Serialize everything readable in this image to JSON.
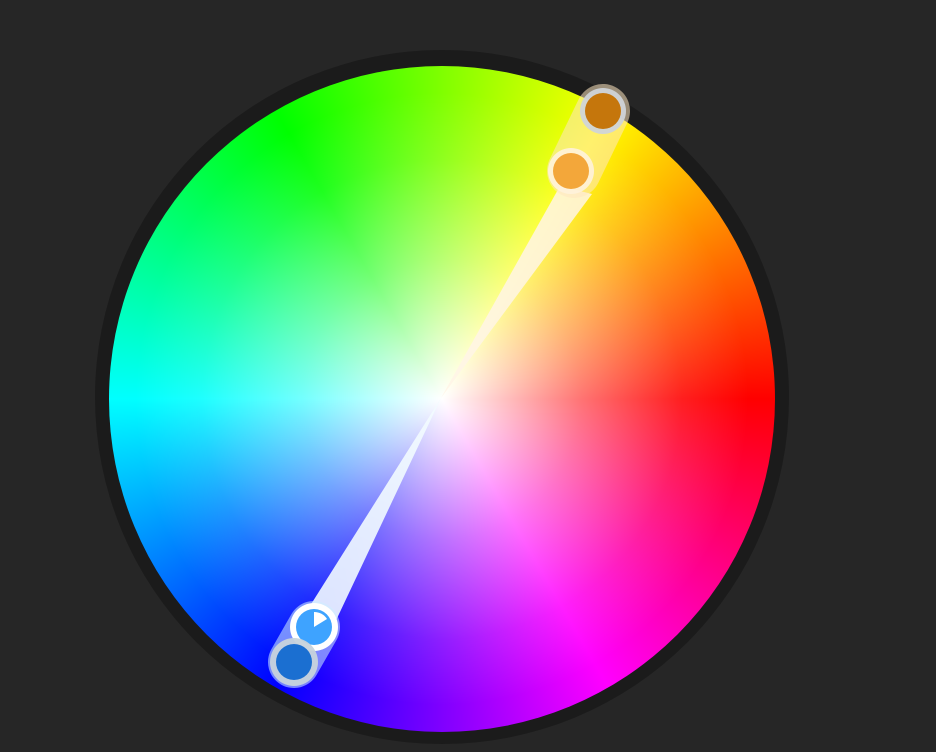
{
  "color_wheel": {
    "harmony": "complementary",
    "base_color": {
      "name": "blue",
      "primary_hex": "#1b6fd1",
      "tint_hex": "#3ea3ff"
    },
    "complement_color": {
      "name": "orange",
      "primary_hex": "#c5760c",
      "tint_hex": "#f3a73a"
    },
    "icons": {
      "base_marker": "pie-quarter-icon"
    }
  }
}
